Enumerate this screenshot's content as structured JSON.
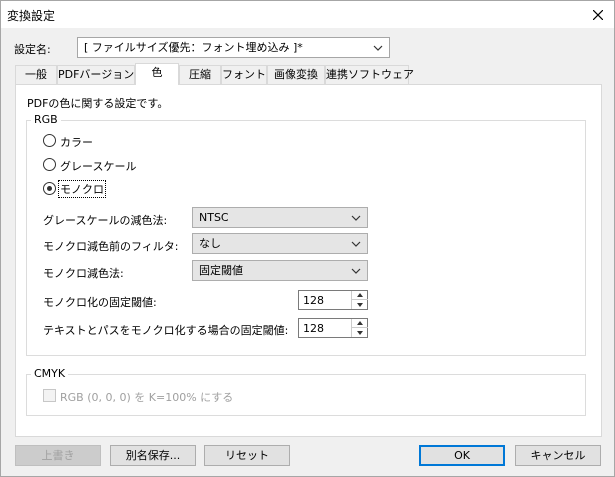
{
  "window": {
    "title": "変換設定"
  },
  "settings": {
    "label": "設定名:",
    "value": "[ ファイルサイズ優先：フォント埋め込み ]*"
  },
  "tabs": [
    {
      "label": "一般"
    },
    {
      "label": "PDFバージョン"
    },
    {
      "label": "色"
    },
    {
      "label": "圧縮"
    },
    {
      "label": "フォント"
    },
    {
      "label": "画像変換"
    },
    {
      "label": "連携ソフトウェア"
    }
  ],
  "panel": {
    "description": "PDFの色に関する設定です。",
    "rgb": {
      "legend": "RGB",
      "radios": [
        {
          "label": "カラー",
          "checked": false
        },
        {
          "label": "グレースケール",
          "checked": false
        },
        {
          "label": "モノクロ",
          "checked": true
        }
      ],
      "fields": [
        {
          "label": "グレースケールの減色法:",
          "value": "NTSC"
        },
        {
          "label": "モノクロ減色前のフィルタ:",
          "value": "なし"
        },
        {
          "label": "モノクロ減色法:",
          "value": "固定閾値"
        }
      ],
      "spinners": [
        {
          "label": "モノクロ化の固定閾値:",
          "value": "128"
        },
        {
          "label": "テキストとパスをモノクロ化する場合の固定閾値:",
          "value": "128"
        }
      ]
    },
    "cmyk": {
      "legend": "CMYK",
      "checkbox_label": "RGB (0, 0, 0) を K=100% にする"
    }
  },
  "buttons": {
    "overwrite": "上書き",
    "save_as": "別名保存...",
    "reset": "リセット",
    "ok": "OK",
    "cancel": "キャンセル"
  },
  "icons": {
    "close": "close-icon",
    "dropdown": "chevron-down-icon"
  }
}
